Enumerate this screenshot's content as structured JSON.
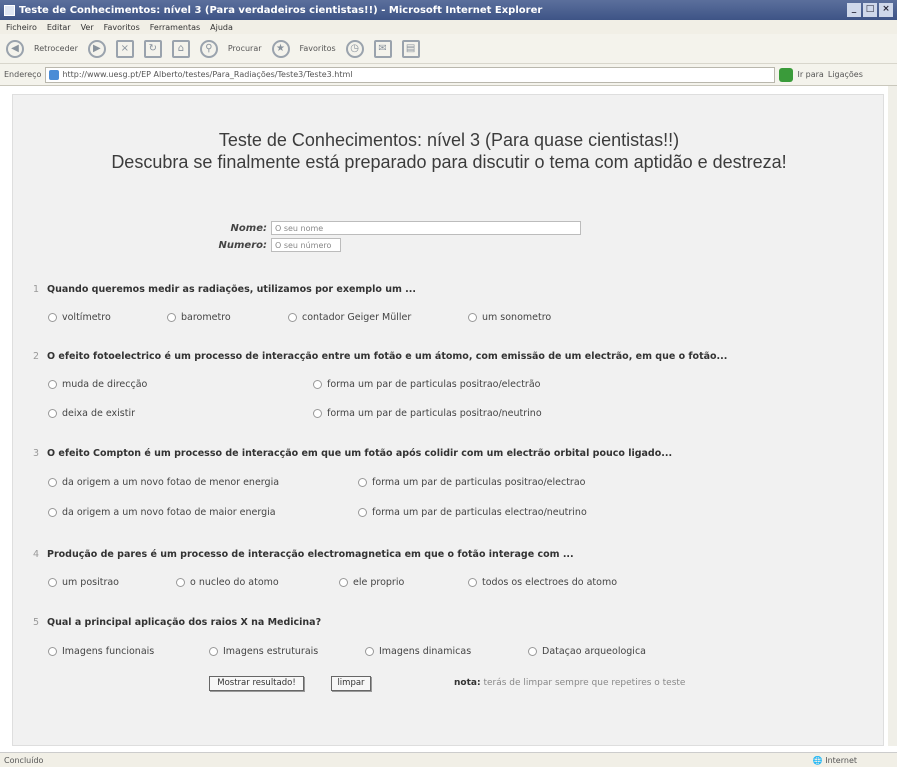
{
  "window": {
    "title": "Teste de Conhecimentos: nível 3 (Para verdadeiros cientistas!!) - Microsoft Internet Explorer"
  },
  "menu": [
    "Ficheiro",
    "Editar",
    "Ver",
    "Favoritos",
    "Ferramentas",
    "Ajuda"
  ],
  "toolbar": {
    "back": "Retroceder",
    "search": "Procurar",
    "favorites": "Favoritos"
  },
  "address": {
    "label": "Endereço",
    "url": "http://www.uesg.pt/EP Alberto/testes/Para_Radiações/Teste3/Teste3.html",
    "go": "Ir para",
    "links": "Ligações"
  },
  "heading": {
    "line1": "Teste de Conhecimentos: nível 3 (Para quase cientistas!!)",
    "line2": "Descubra se finalmente está preparado para discutir o tema com aptidão e destreza!"
  },
  "form": {
    "name_label": "Nome:",
    "name_value": "O seu nome",
    "number_label": "Numero:",
    "number_value": "O seu número"
  },
  "questions": [
    {
      "num": "1",
      "text": "Quando queremos medir as radiações, utilizamos por exemplo um ...",
      "options": [
        "voltímetro",
        "barometro",
        "contador Geiger Müller",
        "um sonometro"
      ]
    },
    {
      "num": "2",
      "text": "O efeito fotoelectrico é um processo de interacção entre um fotão e um átomo, com emissão de um electrão, em que o fotão...",
      "options": [
        "muda de direcção",
        "forma um par de particulas positrao/electrão",
        "deixa de existir",
        "forma um par de particulas positrao/neutrino"
      ]
    },
    {
      "num": "3",
      "text": "O efeito Compton é um processo de interacção em que um fotão após colidir com um electrão orbital pouco ligado...",
      "options": [
        "da origem a um novo fotao de menor energia",
        "forma um par de particulas positrao/electrao",
        "da origem a um novo fotao de maior energia",
        "forma um par de particulas electrao/neutrino"
      ]
    },
    {
      "num": "4",
      "text": "Produção de pares é um processo de interacção electromagnetica em que o fotão interage com ...",
      "options": [
        "um positrao",
        "o nucleo do atomo",
        "ele proprio",
        "todos os electroes do atomo"
      ]
    },
    {
      "num": "5",
      "text": "Qual a principal aplicação dos raios X na Medicina?",
      "options": [
        "Imagens funcionais",
        "Imagens estruturais",
        "Imagens dinamicas",
        "Dataçao arqueologica"
      ]
    }
  ],
  "buttons": {
    "show": "Mostrar resultado!",
    "clear": "limpar"
  },
  "note": {
    "label": "nota:",
    "text": "terás de limpar sempre que repetires o teste"
  },
  "status": {
    "text": "Concluído",
    "zone": "Internet"
  }
}
